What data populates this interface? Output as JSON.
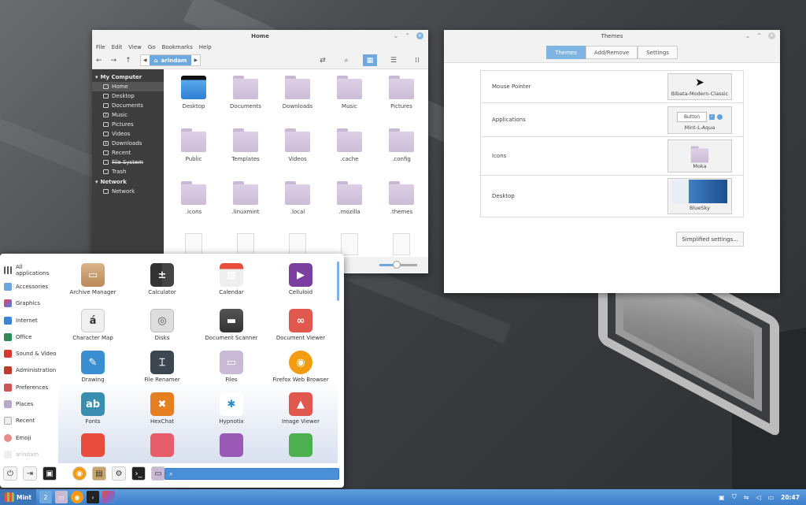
{
  "colors": {
    "accent": "#6fa8dc",
    "taskbar": "#4a8ad4",
    "sidebar": "#3d3d3d"
  },
  "file_manager": {
    "title": "Home",
    "menu": [
      "File",
      "Edit",
      "View",
      "Go",
      "Bookmarks",
      "Help"
    ],
    "path": "arindam",
    "sidebar": {
      "my_computer": "My Computer",
      "items": [
        "Home",
        "Desktop",
        "Documents",
        "Music",
        "Pictures",
        "Videos",
        "Downloads",
        "Recent",
        "File System",
        "Trash"
      ],
      "network": "Network",
      "network_items": [
        "Network"
      ]
    },
    "files": [
      "Desktop",
      "Documents",
      "Downloads",
      "Music",
      "Pictures",
      "Public",
      "Templates",
      "Videos",
      ".cache",
      ".config",
      ".icons",
      ".linuxmint",
      ".local",
      ".mozilla",
      ".themes"
    ],
    "zoom_level": 0.45
  },
  "themes": {
    "title": "Themes",
    "tabs": [
      "Themes",
      "Add/Remove",
      "Settings"
    ],
    "rows": [
      {
        "label": "Mouse Pointer",
        "value": "Bibata-Modern-Classic"
      },
      {
        "label": "Applications",
        "value": "Mint-L-Aqua",
        "button_sample": "Button"
      },
      {
        "label": "Icons",
        "value": "Moka"
      },
      {
        "label": "Desktop",
        "value": "BlueSky"
      }
    ],
    "simplified_button": "Simplified settings..."
  },
  "menu": {
    "categories": [
      "All applications",
      "Accessories",
      "Graphics",
      "Internet",
      "Office",
      "Sound & Video",
      "Administration",
      "Preferences",
      "Places",
      "Recent",
      "Emoji",
      "arindam"
    ],
    "apps": [
      "Archive Manager",
      "Calculator",
      "Calendar",
      "Celluloid",
      "Character Map",
      "Disks",
      "Document Scanner",
      "Document Viewer",
      "Drawing",
      "File Renamer",
      "Files",
      "Firefox Web Browser",
      "Fonts",
      "HexChat",
      "Hypnotix",
      "Image Viewer"
    ],
    "search_placeholder": ""
  },
  "taskbar": {
    "menu_label": "Mint",
    "workspace": "2",
    "clock": "20:47"
  }
}
